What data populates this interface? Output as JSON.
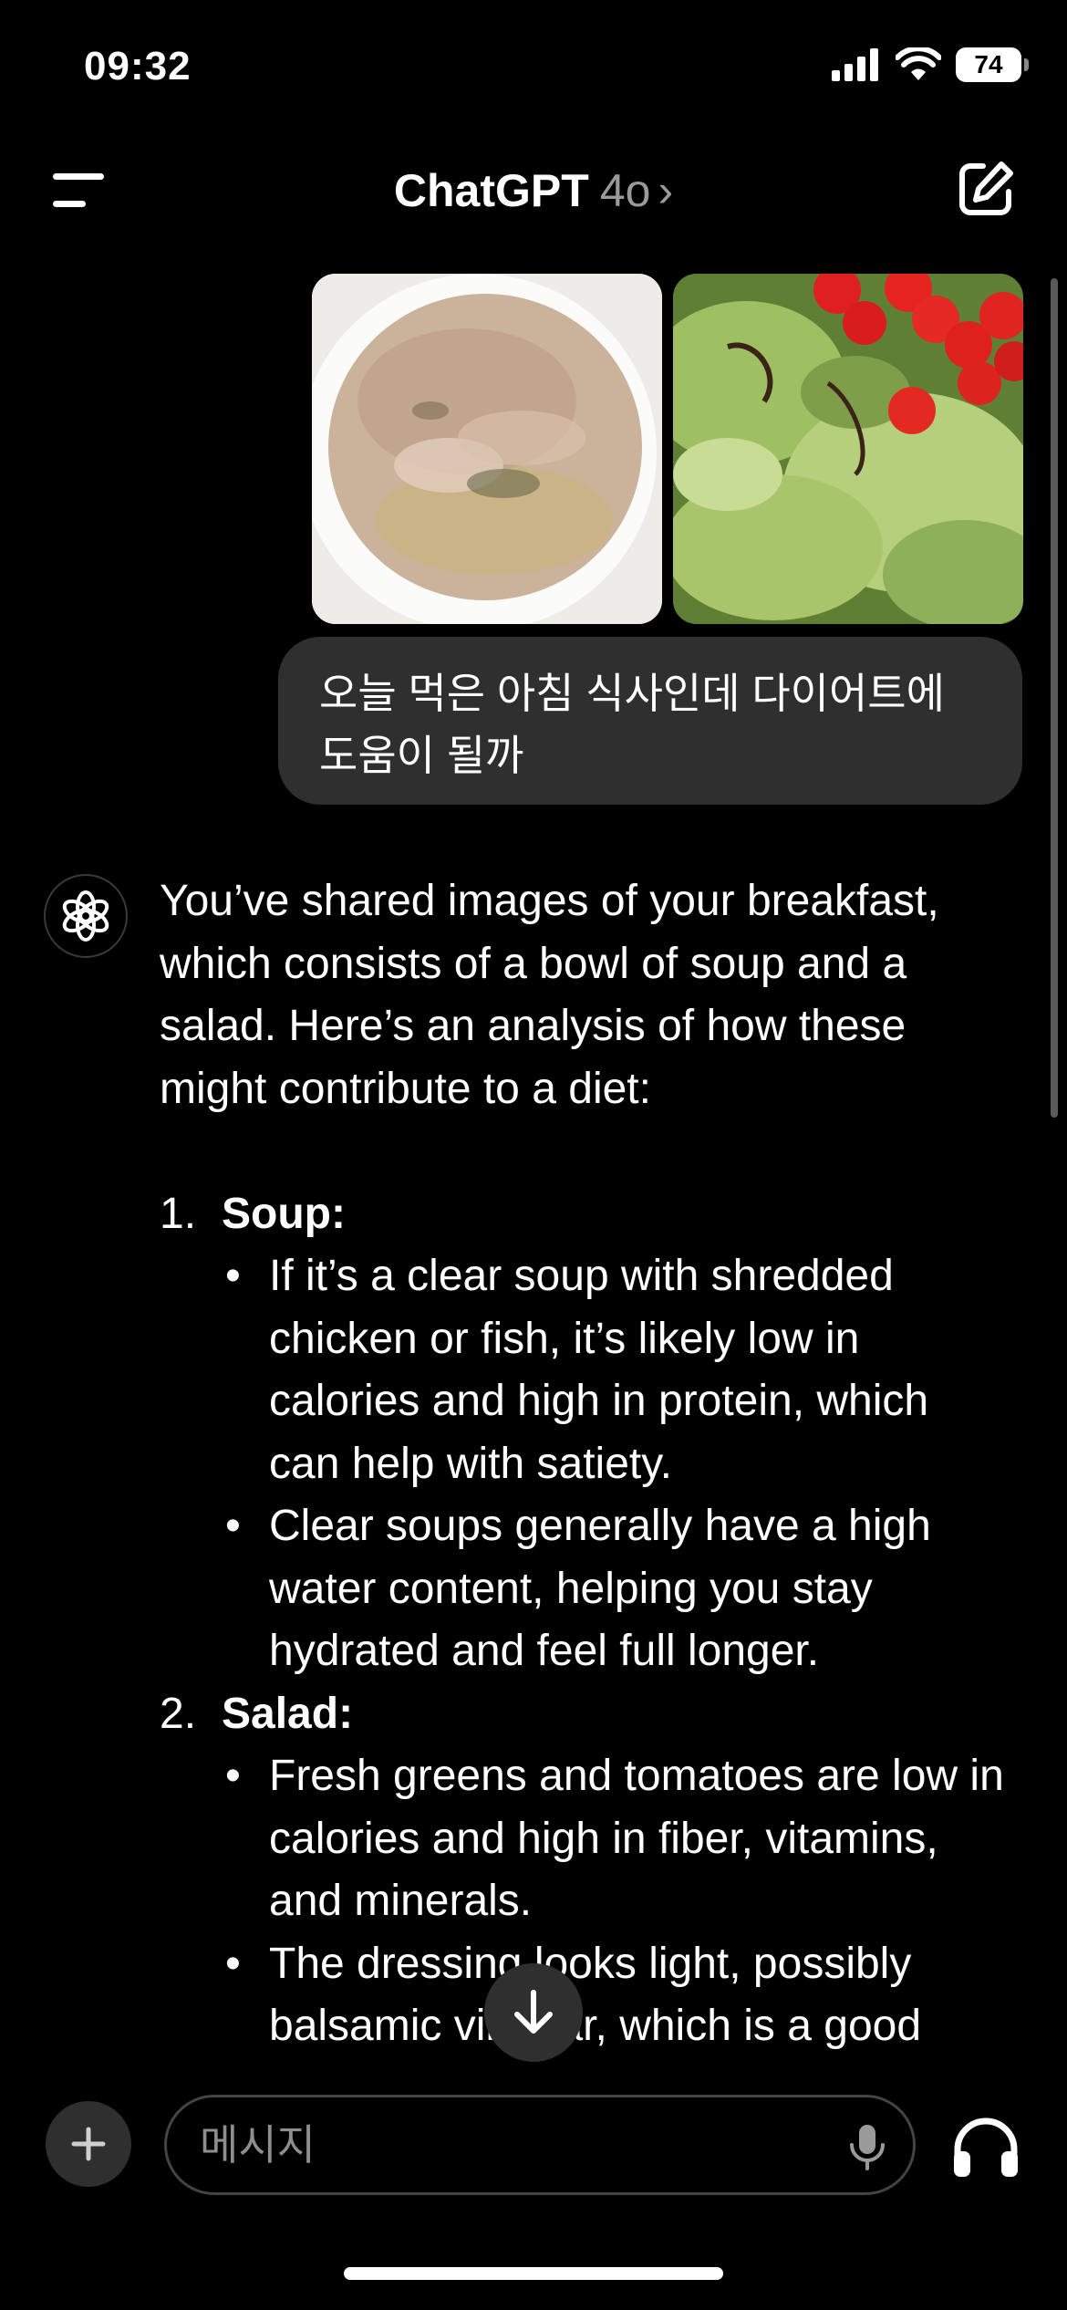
{
  "status_bar": {
    "time": "09:32",
    "battery": "74"
  },
  "header": {
    "app_name": "ChatGPT",
    "model": "4o",
    "chevron": "›"
  },
  "user_message": {
    "line1": "오늘 먹은 아침 식사인데 다이어트에",
    "line2": "도움이 될까"
  },
  "assistant": {
    "intro": "You’ve shared images of your breakfast, which consists of a bowl of soup and a salad. Here’s an analysis of how these might contribute to a diet:",
    "sections": [
      {
        "num": "1.",
        "title": "Soup:",
        "bullets": [
          "If it’s a clear soup with shredded chicken or fish, it’s likely low in calories and high in protein, which can help with satiety.",
          "Clear soups generally have a high water content, helping you stay hydrated and feel full longer."
        ]
      },
      {
        "num": "2.",
        "title": "Salad:",
        "bullets": [
          "Fresh greens and tomatoes are low in calories and high in fiber, vitamins, and minerals.",
          "The dressing looks light, possibly balsamic vinegar, which is a good"
        ]
      }
    ]
  },
  "composer": {
    "placeholder": "메시지"
  },
  "colors": {
    "background": "#000000",
    "bubble": "#2f2f2f",
    "muted": "#9a9a9a"
  },
  "icons": {
    "menu": "menu-icon",
    "new_chat": "compose-icon",
    "avatar": "openai-logo-icon",
    "scroll": "arrow-down-icon",
    "plus": "plus-icon",
    "mic": "mic-icon",
    "voice": "headphones-icon"
  }
}
